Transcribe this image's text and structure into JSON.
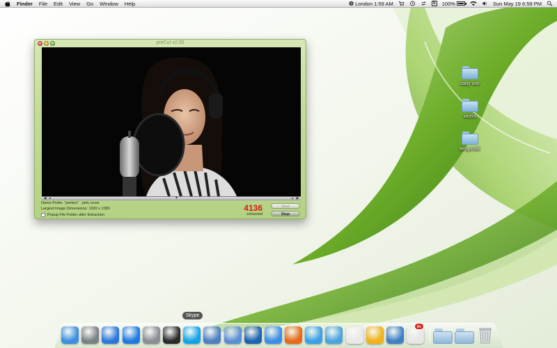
{
  "menubar": {
    "app_name": "Finder",
    "items": [
      "File",
      "Edit",
      "View",
      "Go",
      "Window",
      "Help"
    ],
    "clock_city": "London 1:59 AM",
    "battery_text": "100%",
    "datetime": "Sun May 19  6:59 PM",
    "badge_letter": "S"
  },
  "window": {
    "title": "preCut v2.00",
    "name_prefix": "Name Prefix: \"perfect\" - pink cover",
    "largest_dims": "Largest Image Dimensions: 1920 x 1080",
    "popup_label": "Popup File Folder after Extraction",
    "count": "4136",
    "count_label": "extracted",
    "start_label": "Start",
    "stop_label": "Stop"
  },
  "desktop": {
    "icons": [
      {
        "label": "daily use"
      },
      {
        "label": "works"
      },
      {
        "label": "tempUSE"
      }
    ]
  },
  "dock": {
    "tooltip": "Skype",
    "apps": [
      {
        "name": "finder",
        "color": "#3c8fe0"
      },
      {
        "name": "rocket",
        "color": "#7c7f86"
      },
      {
        "name": "itunes",
        "color": "#2b78d8"
      },
      {
        "name": "app-store",
        "color": "#1e7ae0"
      },
      {
        "name": "system-preferences",
        "color": "#8a8d92"
      },
      {
        "name": "dashboard",
        "color": "#2a2a2a"
      },
      {
        "name": "skype",
        "color": "#13a4e8"
      },
      {
        "name": "preview",
        "color": "#4d7fc2"
      },
      {
        "name": "pen",
        "color": "#5b8fd3"
      },
      {
        "name": "google-earth",
        "color": "#1e62b0"
      },
      {
        "name": "safari",
        "color": "#3b8ee6"
      },
      {
        "name": "firefox",
        "color": "#e66a1a"
      },
      {
        "name": "messages",
        "color": "#3aa0e8"
      },
      {
        "name": "mail",
        "color": "#4aa3df"
      },
      {
        "name": "textedit",
        "color": "#e9e9e9"
      },
      {
        "name": "colorsync",
        "color": "#f1b21b"
      },
      {
        "name": "xcode",
        "color": "#3e7fc6"
      },
      {
        "name": "calendar-badge",
        "color": "#e6e6e6"
      }
    ],
    "badge": "9+"
  }
}
